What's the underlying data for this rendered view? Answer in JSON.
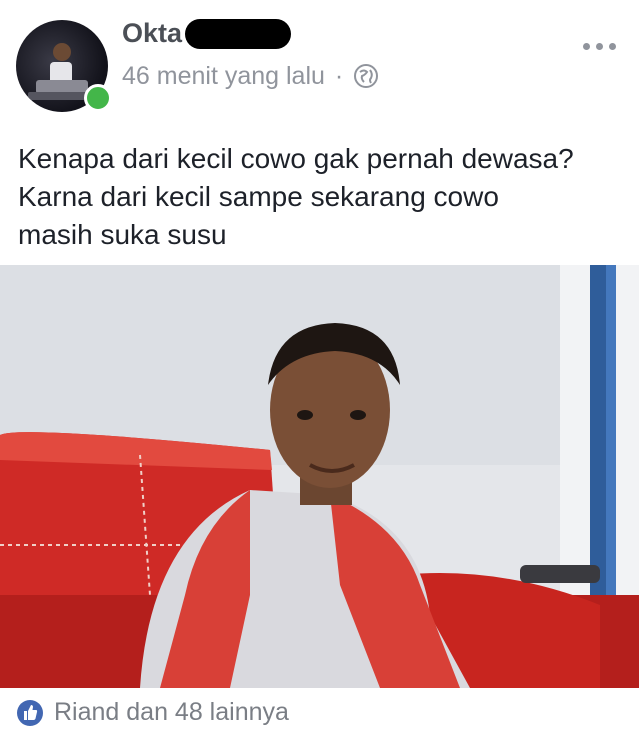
{
  "post": {
    "author_name": "Okta",
    "timestamp": "46 menit yang lalu",
    "separator": "·",
    "text_lines": [
      "Kenapa dari kecil cowo gak pernah dewasa?",
      "Karna dari kecil sampe sekarang cowo",
      "masih suka susu"
    ],
    "reactions_text": "Riand dan 48 lainnya"
  },
  "colors": {
    "name": "#4b4f56",
    "meta": "#90949c",
    "body_text": "#1d2129",
    "like_blue": "#4267b2",
    "online_green": "#43b649"
  },
  "icons": [
    "globe-icon",
    "more-options-icon",
    "like-icon"
  ]
}
